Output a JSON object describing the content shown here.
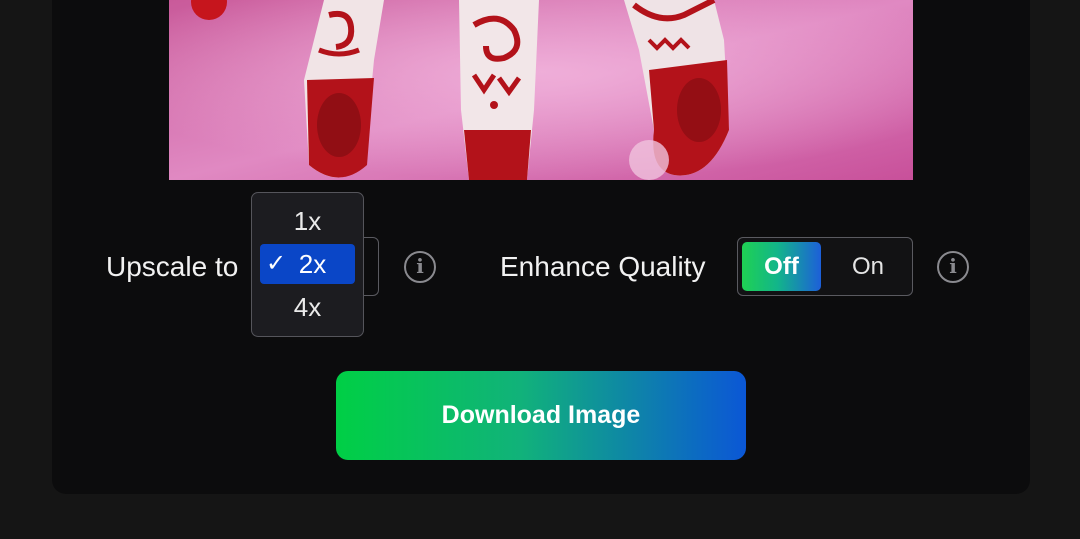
{
  "upscale": {
    "label": "Upscale to",
    "options": [
      "1x",
      "2x",
      "4x"
    ],
    "selected": "2x",
    "check_mark": "✓"
  },
  "enhance": {
    "label": "Enhance Quality",
    "off_label": "Off",
    "on_label": "On",
    "state": "Off"
  },
  "download": {
    "label": "Download Image"
  },
  "icons": {
    "info": "i"
  },
  "colors": {
    "background": "#151515",
    "panel": "#0c0c0d",
    "selected_option": "#0a46c7",
    "gradient_start": "#00cf45",
    "gradient_end": "#0b57d6"
  }
}
